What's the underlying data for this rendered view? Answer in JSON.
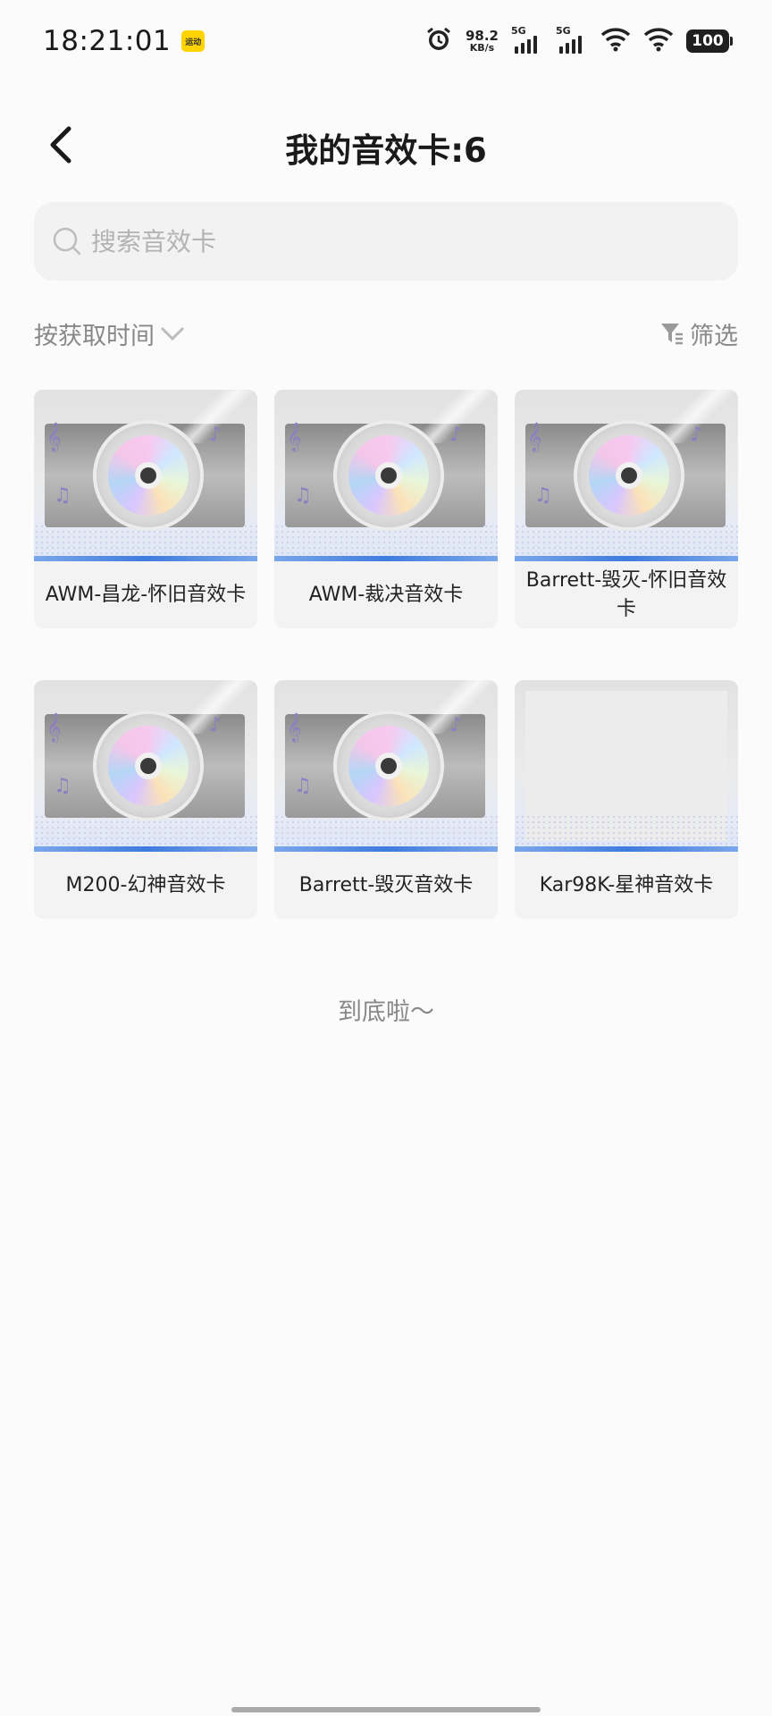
{
  "status_bar": {
    "time": "18:21:01",
    "badge": "运动",
    "net_speed_value": "98.2",
    "net_speed_unit": "KB/s",
    "sim1_label": "5G",
    "sim2_label": "5G",
    "battery": "100"
  },
  "header": {
    "title": "我的音效卡:6"
  },
  "search": {
    "placeholder": "搜索音效卡",
    "value": ""
  },
  "toolbar": {
    "sort_label": "按获取时间",
    "filter_label": "筛选"
  },
  "cards": [
    {
      "name": "AWM-昌龙-怀旧音效卡",
      "has_art": true
    },
    {
      "name": "AWM-裁决音效卡",
      "has_art": true
    },
    {
      "name": "Barrett-毁灭-怀旧音效卡",
      "has_art": true
    },
    {
      "name": "M200-幻神音效卡",
      "has_art": true
    },
    {
      "name": "Barrett-毁灭音效卡",
      "has_art": true
    },
    {
      "name": "Kar98K-星神音效卡",
      "has_art": false
    }
  ],
  "footer": {
    "end_text": "到底啦～"
  },
  "colors": {
    "accent_blue": "#3f7bdf",
    "note_purple": "#8d7fc2"
  }
}
